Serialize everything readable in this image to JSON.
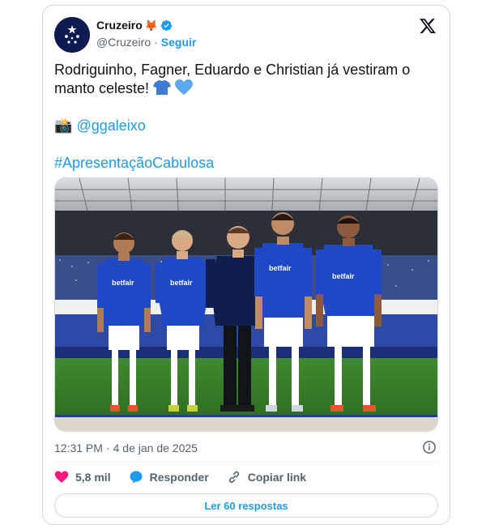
{
  "author": {
    "display_name": "Cruzeiro",
    "name_emoji": "🦊",
    "handle": "@Cruzeiro",
    "separator": "·",
    "follow_label": "Seguir"
  },
  "tweet": {
    "line1": "Rodriguinho, Fagner, Eduardo e Christian já vestiram o",
    "line2": "manto celeste!",
    "camera_emoji": "📸",
    "mention": "@ggaleixo",
    "hashtag": "#ApresentaçãoCabulosa"
  },
  "photo": {
    "sponsor": "betfair"
  },
  "meta": {
    "time": "12:31 PM",
    "separator": "·",
    "date": "4 de jan de 2025"
  },
  "actions": {
    "likes": "5,8 mil",
    "reply_label": "Responder",
    "copy_link_label": "Copiar link"
  },
  "read_replies_label": "Ler 60 respostas",
  "colors": {
    "accent": "#1d9bf0",
    "like": "#f91880",
    "cruzeiro_blue": "#1a3fb0"
  }
}
